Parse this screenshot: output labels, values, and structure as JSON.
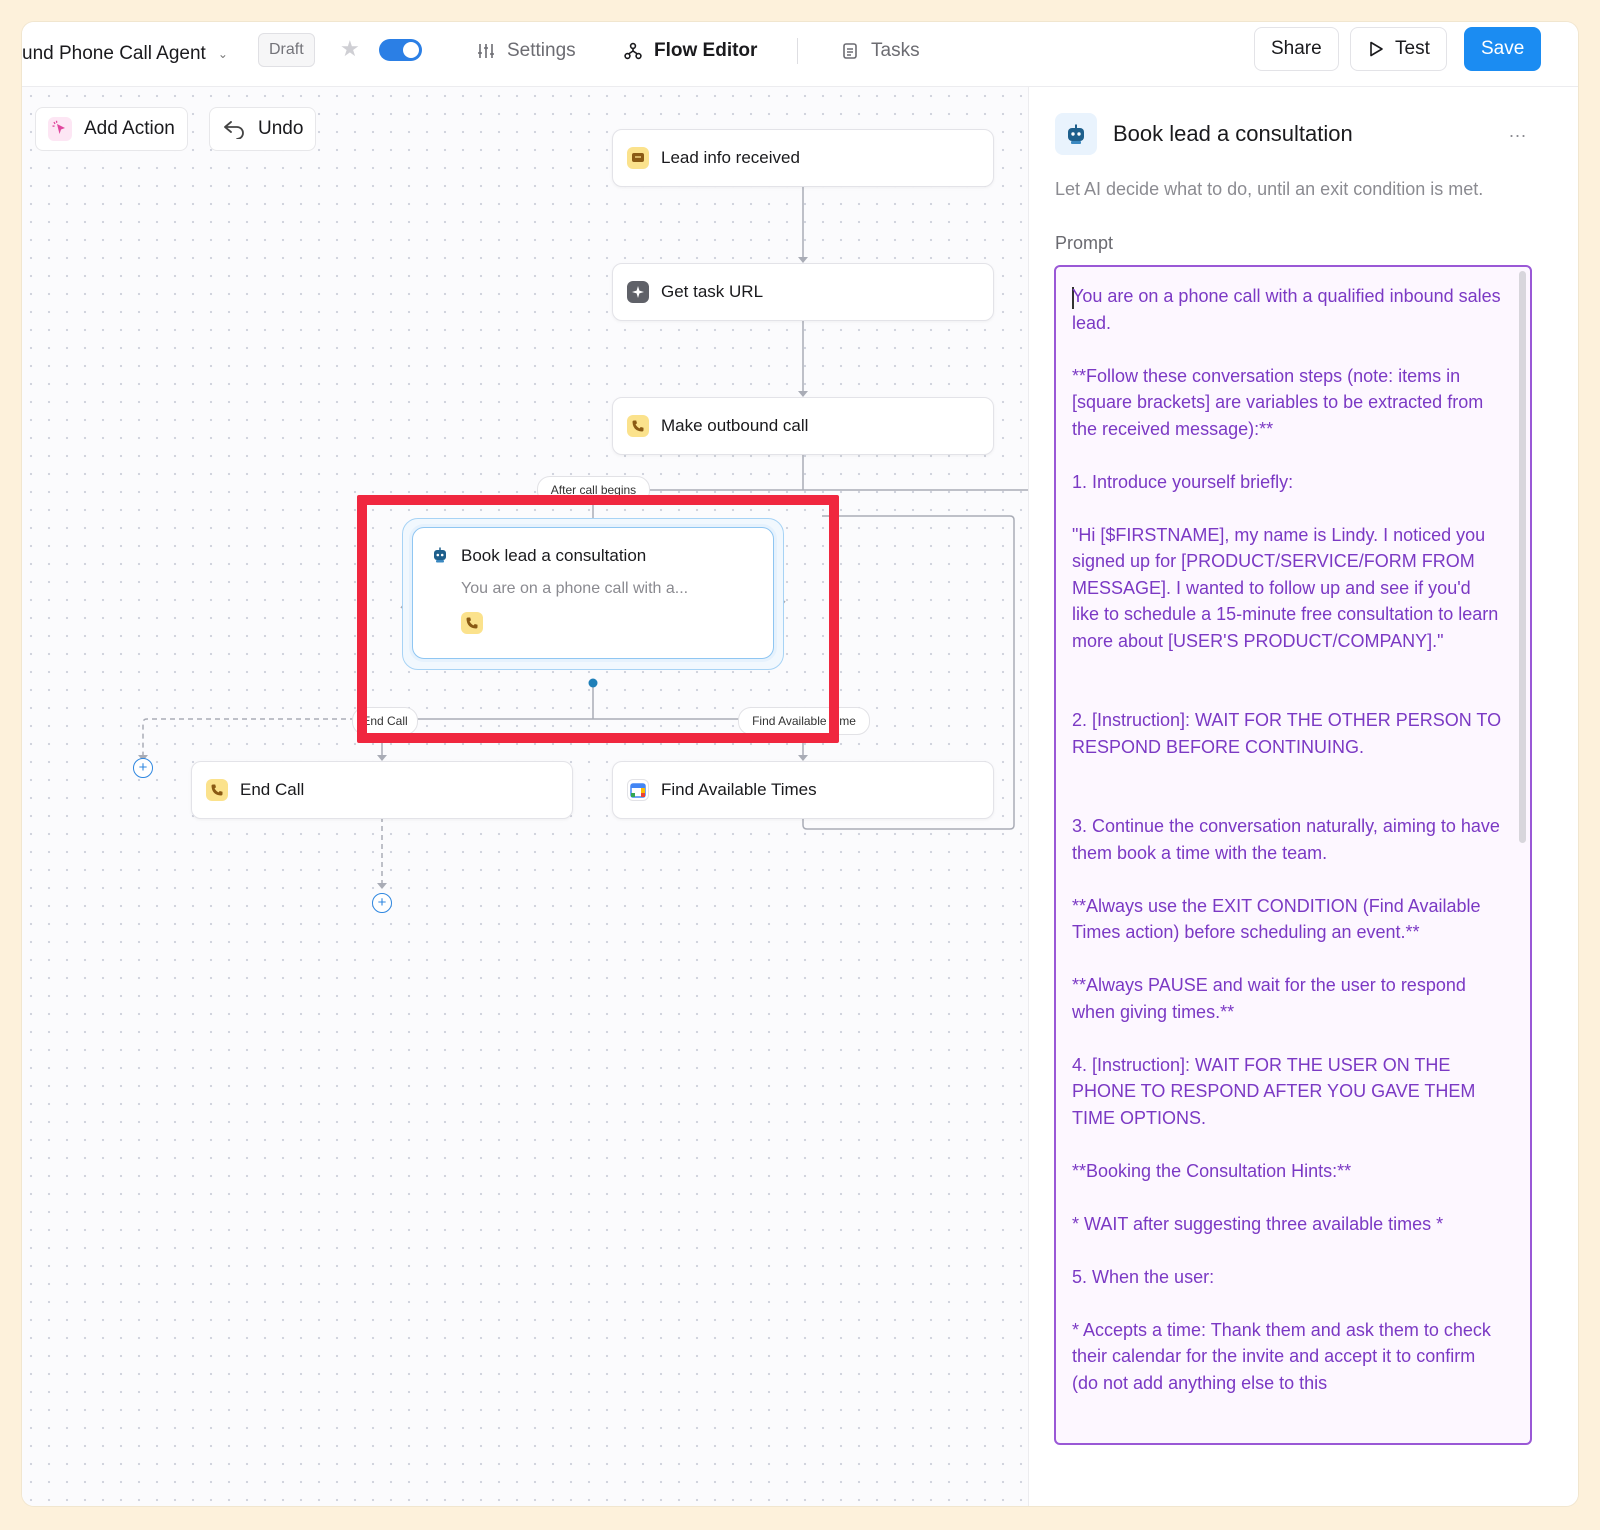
{
  "header": {
    "agent_title": "und Phone Call Agent",
    "status": "Draft",
    "nav": [
      {
        "label": "Settings",
        "icon": "sliders-icon"
      },
      {
        "label": "Flow Editor",
        "icon": "flow-icon"
      },
      {
        "label": "Tasks",
        "icon": "clipboard-icon"
      }
    ],
    "share_label": "Share",
    "test_label": "Test",
    "save_label": "Save",
    "accent": "#1b8cf2"
  },
  "canvas": {
    "add_action_label": "Add Action",
    "undo_label": "Undo",
    "nodes": {
      "trigger": "Lead info received",
      "get_task": "Get task URL",
      "outbound_call": "Make outbound call",
      "ai_agent_title": "Book lead a consultation",
      "ai_agent_preview": "You are on a phone call with a...",
      "end_call": "End Call",
      "find_times": "Find Available Times"
    },
    "edge_labels": {
      "after_call": "After call begins",
      "end_call": "End Call",
      "find_times": "Find Available Time"
    },
    "highlight_color": "#f0273f"
  },
  "panel": {
    "title": "Book lead a consultation",
    "more": "...",
    "description": "Let AI decide what to do, until an exit condition is met.",
    "prompt_label": "Prompt",
    "prompt_text": "You are on a phone call with a qualified inbound sales lead.\n\n**Follow these conversation steps (note: items in [square brackets] are variables to be extracted from the received message):**\n\n1. Introduce yourself briefly:\n\n\"Hi [$FIRSTNAME], my name is Lindy. I noticed you signed up for [PRODUCT/SERVICE/FORM FROM MESSAGE]. I wanted to follow up and see if you'd like to schedule a 15-minute free consultation to learn more about [USER'S PRODUCT/COMPANY].\"\n\n\n2. [Instruction]: WAIT FOR THE OTHER PERSON TO RESPOND BEFORE CONTINUING.\n\n\n3. Continue the conversation naturally, aiming to have them book a time with the team.\n\n**Always use the EXIT CONDITION (Find Available Times action) before scheduling an event.**\n\n**Always PAUSE and wait for the user to respond when giving times.**\n\n4. [Instruction]: WAIT FOR THE USER ON THE PHONE TO RESPOND AFTER YOU GAVE THEM TIME OPTIONS.\n\n**Booking the Consultation Hints:**\n\n* WAIT after suggesting three available times *\n\n5. When the user:\n\n* Accepts a time: Thank them and ask them to check their calendar for the invite and accept it to confirm (do not add anything else to this",
    "prompt_color": "#7b39c4"
  }
}
